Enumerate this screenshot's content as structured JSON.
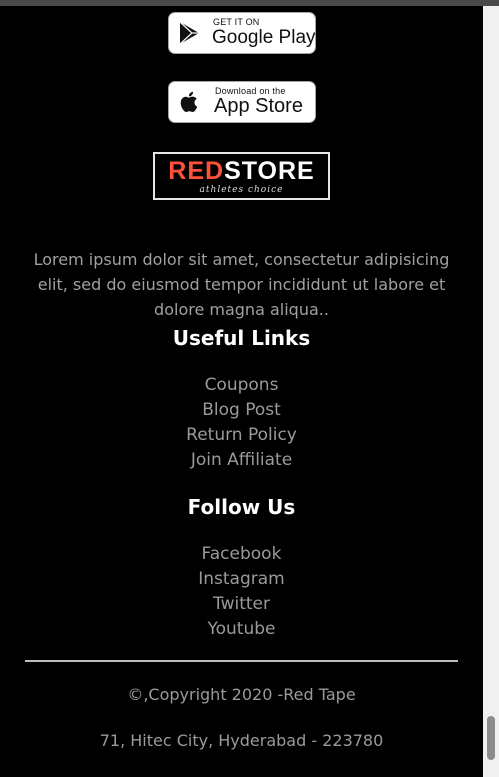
{
  "badges": {
    "google": {
      "small": "GET IT ON",
      "big": "Google Play",
      "icon": "google-play-icon"
    },
    "apple": {
      "small": "Download on the",
      "big": "App Store",
      "icon": "apple-icon"
    }
  },
  "logo": {
    "red_part": "RED",
    "white_part": "STORE",
    "tagline": "athletes choice"
  },
  "description": "Lorem ipsum dolor sit amet, consectetur adipisicing elit, sed do eiusmod tempor incididunt ut labore et dolore magna aliqua..",
  "useful_links": {
    "heading": "Useful Links",
    "items": [
      "Coupons",
      "Blog Post",
      "Return Policy",
      "Join Affiliate"
    ]
  },
  "follow_us": {
    "heading": "Follow Us",
    "items": [
      "Facebook",
      "Instagram",
      "Twitter",
      "Youtube"
    ]
  },
  "footer": {
    "copyright": "©,Copyright 2020 -Red Tape",
    "address": "71, Hitec City, Hyderabad - 223780"
  },
  "colors": {
    "background": "#000000",
    "accent": "#ff523b",
    "heading": "#ffffff",
    "text": "#9a9a9a"
  }
}
